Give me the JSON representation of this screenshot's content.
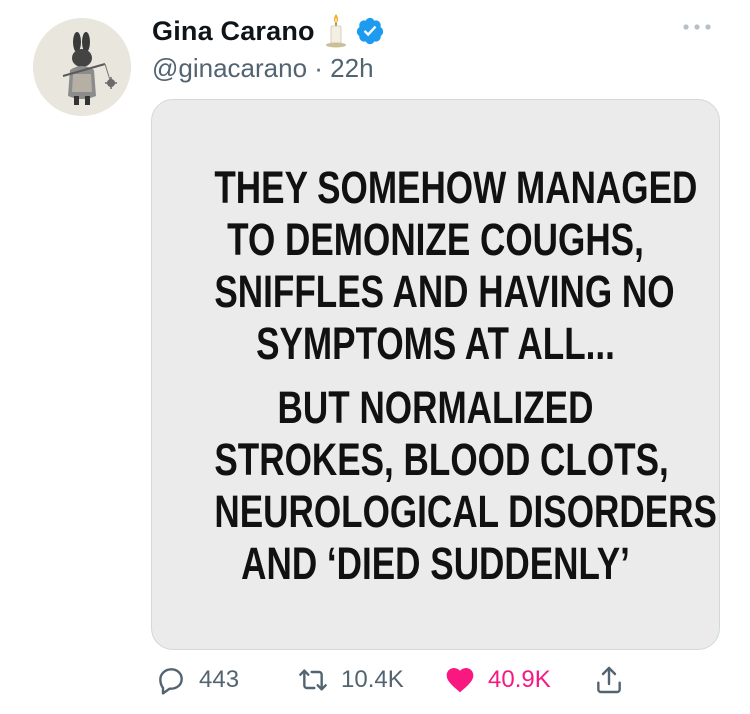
{
  "tweet": {
    "author_name": "Gina Carano",
    "handle_line": "@ginacarano · 22h",
    "avatar_icon": "bunny-knight-icon",
    "candle_icon": "candle-icon",
    "verified_icon": "verified-badge-icon",
    "more_icon": "more-options-icon"
  },
  "media": {
    "lines_top": [
      "THEY SOMEHOW MANAGED",
      "TO DEMONIZE COUGHS,",
      "SNIFFLES AND HAVING NO",
      "SYMPTOMS AT ALL..."
    ],
    "lines_bottom": [
      "BUT NORMALIZED",
      "STROKES, BLOOD CLOTS,",
      "NEUROLOGICAL DISORDERS",
      "AND ‘DIED SUDDENLY’"
    ]
  },
  "actions": {
    "replies": "443",
    "retweets": "10.4K",
    "likes": "40.9K"
  },
  "colors": {
    "text": "#0f1419",
    "secondary": "#536471",
    "verified": "#1d9bf0",
    "like": "#f91880"
  }
}
